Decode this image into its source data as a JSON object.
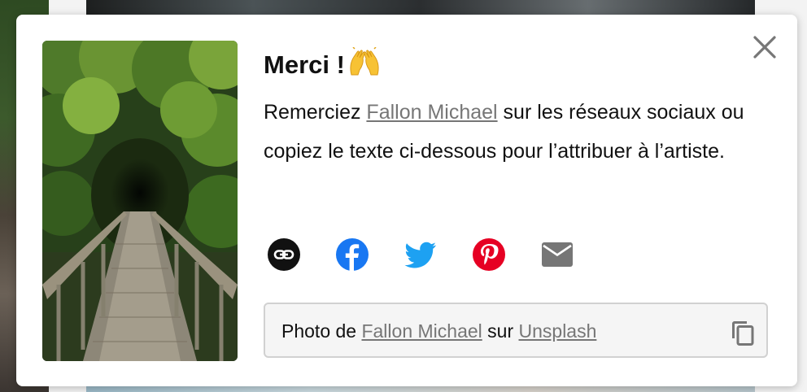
{
  "dialog": {
    "title": "Merci !",
    "title_emoji": "raising-hands-emoji",
    "description_before": "Remerciez ",
    "artist_name": "Fallon Michael",
    "description_after": " sur les réseaux sociaux ou copiez le texte ci-dessous pour l’attribuer à l’artiste.",
    "share_icons": [
      "link-icon",
      "facebook-icon",
      "twitter-icon",
      "pinterest-icon",
      "email-icon"
    ],
    "attribution": {
      "prefix": "Photo de ",
      "artist_name": "Fallon Michael",
      "middle": " sur ",
      "site_name": "Unsplash"
    }
  },
  "colors": {
    "facebook": "#1877f2",
    "twitter": "#1da1f2",
    "pinterest": "#e60023",
    "link_text": "#767676"
  }
}
